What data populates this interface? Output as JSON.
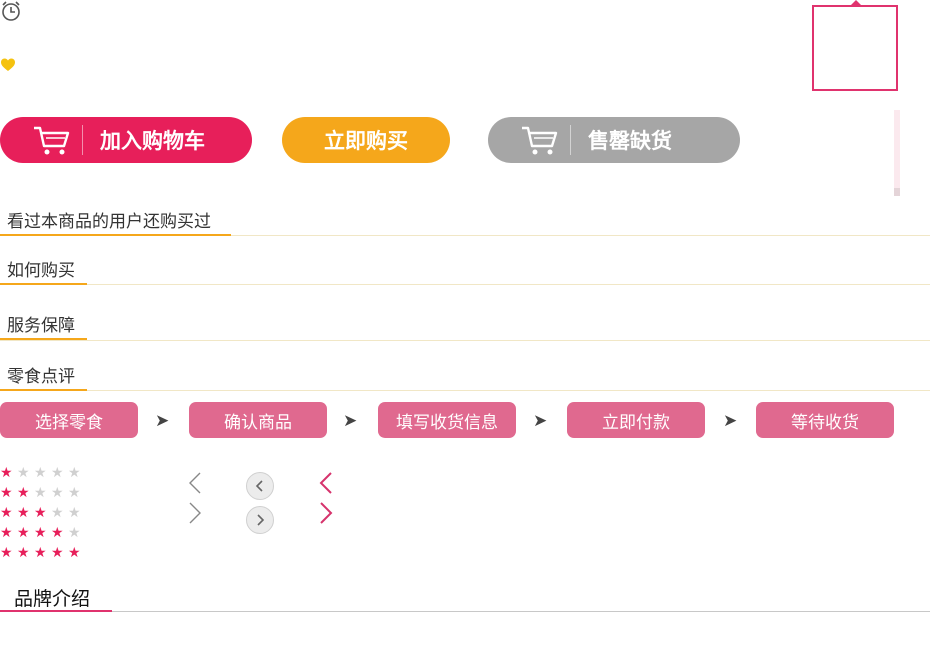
{
  "icons": {
    "clock": "alarm-clock-icon",
    "heart": "heart-icon",
    "cart": "cart-icon"
  },
  "colors": {
    "accent": "#e71f5a",
    "orange": "#f5a71b",
    "disabled": "#a6a6a6",
    "step": "#e0698f",
    "frame": "#e0336e"
  },
  "actions": {
    "add_to_cart": "加入购物车",
    "buy_now": "立即购买",
    "sold_out": "售罄缺货"
  },
  "sections": {
    "also_bought": "看过本商品的用户还购买过",
    "how_to_buy": "如何购买",
    "service": "服务保障",
    "reviews": "零食点评"
  },
  "steps": [
    "选择零食",
    "确认商品",
    "填写收货信息",
    "立即付款",
    "等待收货"
  ],
  "step_arrow": "➤",
  "ratings": [
    1,
    2,
    3,
    4,
    5
  ],
  "brand": {
    "title": "品牌介绍"
  }
}
